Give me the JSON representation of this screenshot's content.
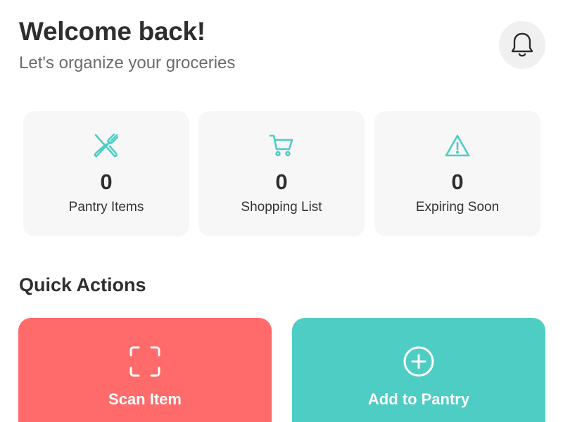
{
  "header": {
    "title": "Welcome back!",
    "subtitle": "Let's organize your groceries",
    "notification_icon": "bell-icon"
  },
  "stats": [
    {
      "icon": "utensils-icon",
      "count": "0",
      "label": "Pantry Items"
    },
    {
      "icon": "cart-icon",
      "count": "0",
      "label": "Shopping List"
    },
    {
      "icon": "warning-icon",
      "count": "0",
      "label": "Expiring Soon"
    }
  ],
  "quick_actions": {
    "title": "Quick Actions",
    "items": [
      {
        "icon": "scan-icon",
        "label": "Scan Item"
      },
      {
        "icon": "plus-circle-icon",
        "label": "Add to Pantry"
      }
    ]
  },
  "colors": {
    "accent": "#4ecdc4",
    "scan_card": "#ff6b6b",
    "add_card": "#4ecdc4",
    "card_background": "#f7f7f7",
    "text_dark": "#2e2e2e"
  }
}
